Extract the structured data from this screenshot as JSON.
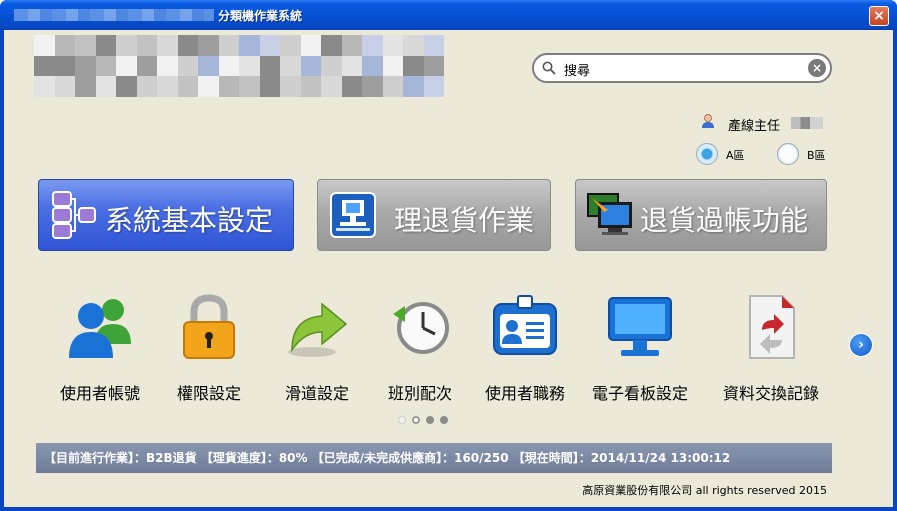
{
  "window": {
    "title": "分類機作業系統",
    "close_label": "×"
  },
  "search": {
    "value": "搜尋",
    "clear_label": "×"
  },
  "user": {
    "role_label": "產線主任"
  },
  "zones": [
    {
      "label": "A區",
      "checked": true
    },
    {
      "label": "B區",
      "checked": false
    }
  ],
  "main_buttons": [
    {
      "label": "系統基本設定",
      "icon": "network-icon",
      "active": true
    },
    {
      "label": "理退貨作業",
      "icon": "workstation-icon",
      "active": false
    },
    {
      "label": "退貨過帳功能",
      "icon": "monitor-arrow-icon",
      "active": false
    }
  ],
  "tiles": [
    {
      "label": "使用者帳號",
      "icon": "users-icon"
    },
    {
      "label": "權限設定",
      "icon": "padlock-icon"
    },
    {
      "label": "滑道設定",
      "icon": "curved-arrow-icon"
    },
    {
      "label": "班別配次",
      "icon": "clock-icon"
    },
    {
      "label": "使用者職務",
      "icon": "id-badge-icon"
    },
    {
      "label": "電子看板設定",
      "icon": "display-icon"
    },
    {
      "label": "資料交換記錄",
      "icon": "document-exchange-icon"
    }
  ],
  "carousel": {
    "next_label": "›",
    "pages": 4,
    "current": 1
  },
  "status_bar": {
    "text": "【目前進行作業】：B2B退貨 【理貨進度】：80% 【已完成/未完成供應商】：160/250 【現在時間】：2014/11/24 13:00:12"
  },
  "footer": {
    "copyright": "高原資業股份有限公司 all rights reserved 2015"
  },
  "colors": {
    "titlebar": "#0552d6",
    "client_bg": "#ece9d8",
    "primary_button": "#3f62dd",
    "secondary_button": "#aaaaaa",
    "status_bar": "#7f8ca7"
  }
}
